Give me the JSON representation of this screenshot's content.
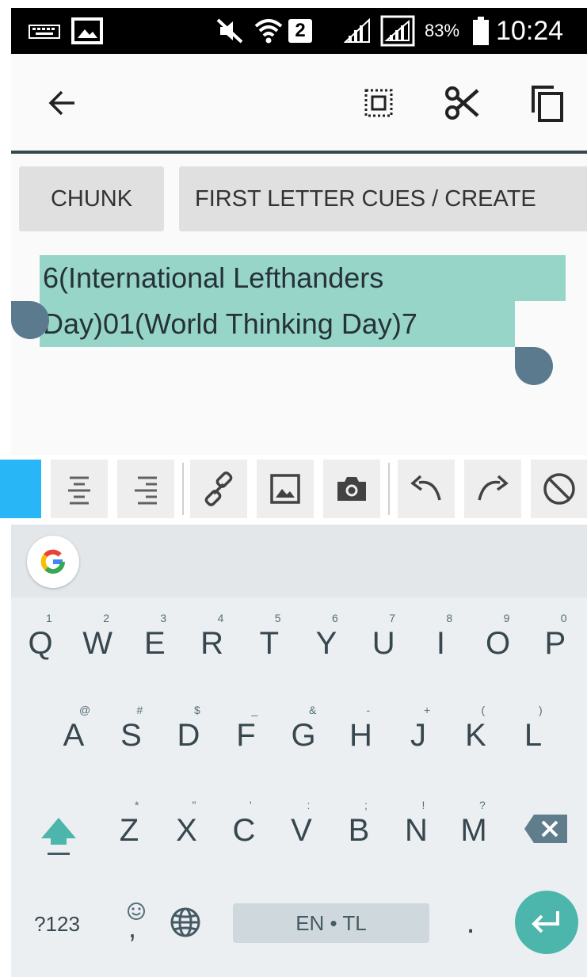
{
  "status_bar": {
    "battery_percent": "83%",
    "time": "10:24",
    "sim_slot": "2",
    "icons": [
      "keyboard-icon",
      "image-icon",
      "mute-icon",
      "wifi-icon",
      "signal-icon",
      "battery-icon"
    ]
  },
  "action_bar": {
    "icons": [
      "back-arrow-icon",
      "select-all-icon",
      "cut-icon",
      "copy-icon"
    ]
  },
  "chips": [
    {
      "label": "CHUNK"
    },
    {
      "label": "FIRST LETTER CUES / CREATE"
    }
  ],
  "editor": {
    "line1": "6(International Lefthanders",
    "line2": "Day)01(World Thinking Day)7"
  },
  "format_toolbar": {
    "icons": [
      "align-left-icon",
      "align-center-icon",
      "align-right-icon",
      "link-icon",
      "image-icon",
      "camera-icon",
      "undo-icon",
      "redo-icon",
      "clear-format-icon"
    ]
  },
  "keyboard": {
    "row1": [
      {
        "key": "Q",
        "hint": "1"
      },
      {
        "key": "W",
        "hint": "2"
      },
      {
        "key": "E",
        "hint": "3"
      },
      {
        "key": "R",
        "hint": "4"
      },
      {
        "key": "T",
        "hint": "5"
      },
      {
        "key": "Y",
        "hint": "6"
      },
      {
        "key": "U",
        "hint": "7"
      },
      {
        "key": "I",
        "hint": "8"
      },
      {
        "key": "O",
        "hint": "9"
      },
      {
        "key": "P",
        "hint": "0"
      }
    ],
    "row2": [
      {
        "key": "A",
        "hint": "@"
      },
      {
        "key": "S",
        "hint": "#"
      },
      {
        "key": "D",
        "hint": "$"
      },
      {
        "key": "F",
        "hint": "_"
      },
      {
        "key": "G",
        "hint": "&"
      },
      {
        "key": "H",
        "hint": "-"
      },
      {
        "key": "J",
        "hint": "+"
      },
      {
        "key": "K",
        "hint": "("
      },
      {
        "key": "L",
        "hint": ")"
      }
    ],
    "row3": [
      {
        "key": "Z",
        "hint": "*"
      },
      {
        "key": "X",
        "hint": "\""
      },
      {
        "key": "C",
        "hint": "'"
      },
      {
        "key": "V",
        "hint": ":"
      },
      {
        "key": "B",
        "hint": ";"
      },
      {
        "key": "N",
        "hint": "!"
      },
      {
        "key": "M",
        "hint": "?"
      }
    ],
    "symbols_key": "?123",
    "comma_key": ",",
    "period_key": ".",
    "space_label": "EN • TL",
    "accent_color": "#4db6ac"
  }
}
